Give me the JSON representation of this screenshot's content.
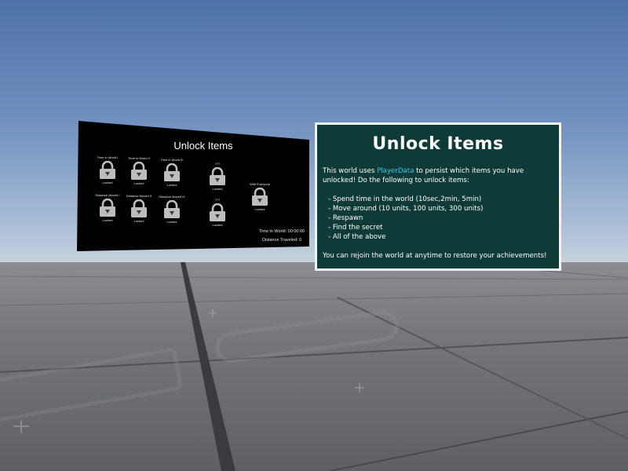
{
  "left_panel": {
    "title": "Unlock Items",
    "items": [
      {
        "label": "Time in World I",
        "status": "Locked"
      },
      {
        "label": "Time in World II",
        "status": "Locked"
      },
      {
        "label": "Time in World III",
        "status": "Locked"
      },
      {
        "label": "Distance Moved I",
        "status": "Locked"
      },
      {
        "label": "Distance Moved II",
        "status": "Locked"
      },
      {
        "label": "Distance Moved III",
        "status": "Locked"
      },
      {
        "label": "???",
        "status": "Locked"
      },
      {
        "label": "???",
        "status": "Locked"
      },
      {
        "label": "With Everyone",
        "status": "Locked"
      }
    ],
    "time_in_world": "Time in World: 00:00:00",
    "distance_traveled": "Distance Traveled: 0"
  },
  "right_panel": {
    "title": "Unlock Items",
    "intro_prefix": "This world uses ",
    "intro_highlight": "PlayerData",
    "intro_suffix": " to persist which items you have",
    "intro_line2": "unlocked! Do the following to unlock items:",
    "list": [
      "- Spend time in the world (10sec,2min, 5min)",
      "- Move around (10 units, 100 units, 300 units)",
      "- Respawn",
      "- Find the secret",
      "- All of the above"
    ],
    "footer": "You can rejoin the world at anytime to restore your achievements!"
  },
  "colors": {
    "panel_bg": "#0e3a37",
    "highlight": "#31c6e3",
    "left_panel_bg": "#000000"
  }
}
